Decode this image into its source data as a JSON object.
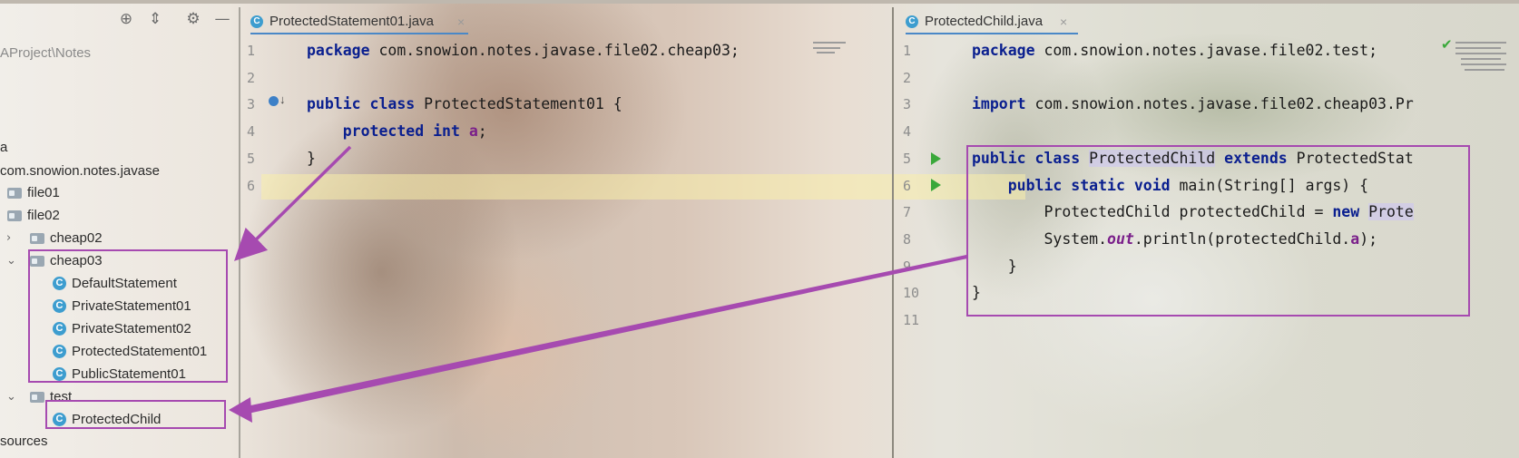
{
  "colors": {
    "accent_box": "#a64ab0",
    "keyword": "#0a1f8f",
    "field": "#7a1f8a",
    "run": "#3aa83a",
    "class_icon": "#3d9dcf"
  },
  "project": {
    "path": "AProject\\Notes",
    "toolbar_icons": [
      "target-icon",
      "collapse-icon",
      "gear-icon",
      "minimize-icon"
    ],
    "tree": [
      {
        "label": "a",
        "type": "text"
      },
      {
        "label": "com.snowion.notes.javase",
        "type": "package"
      },
      {
        "label": "file01",
        "type": "folder"
      },
      {
        "label": "file02",
        "type": "folder"
      },
      {
        "label": "cheap02",
        "type": "folder",
        "expander": "›"
      },
      {
        "label": "cheap03",
        "type": "folder",
        "expander": "⌄"
      },
      {
        "label": "DefaultStatement",
        "type": "class"
      },
      {
        "label": "PrivateStatement01",
        "type": "class"
      },
      {
        "label": "PrivateStatement02",
        "type": "class"
      },
      {
        "label": "ProtectedStatement01",
        "type": "class"
      },
      {
        "label": "PublicStatement01",
        "type": "class"
      },
      {
        "label": "test",
        "type": "folder",
        "expander": "⌄"
      },
      {
        "label": "ProtectedChild",
        "type": "class"
      },
      {
        "label": "sources",
        "type": "text"
      }
    ]
  },
  "left_editor": {
    "tab": {
      "name": "ProtectedStatement01.java",
      "icon": "C",
      "close": "×"
    },
    "line_numbers": [
      "1",
      "2",
      "3",
      "4",
      "5",
      "6"
    ],
    "lines": [
      [
        {
          "t": "package",
          "c": "kw"
        },
        {
          "t": " com.snowion.notes.javase.file02.cheap03;",
          "c": ""
        }
      ],
      [],
      [
        {
          "t": "public class",
          "c": "kw"
        },
        {
          "t": " ProtectedStatement01 {",
          "c": ""
        }
      ],
      [
        {
          "t": "    ",
          "c": ""
        },
        {
          "t": "protected int",
          "c": "kw"
        },
        {
          "t": " ",
          "c": ""
        },
        {
          "t": "a",
          "c": "fld"
        },
        {
          "t": ";",
          "c": ""
        }
      ],
      [
        {
          "t": "}",
          "c": ""
        }
      ],
      []
    ]
  },
  "right_editor": {
    "tab": {
      "name": "ProtectedChild.java",
      "icon": "C",
      "close": "×"
    },
    "line_numbers": [
      "1",
      "2",
      "3",
      "4",
      "5",
      "6",
      "7",
      "8",
      "9",
      "10",
      "11"
    ],
    "lines": [
      [
        {
          "t": "package",
          "c": "kw"
        },
        {
          "t": " com.snowion.notes.javase.file02.test;",
          "c": ""
        }
      ],
      [],
      [
        {
          "t": "import",
          "c": "kw"
        },
        {
          "t": " com.snowion.notes.javase.file02.cheap03.Pr",
          "c": ""
        }
      ],
      [],
      [
        {
          "t": "public class",
          "c": "kw"
        },
        {
          "t": " ",
          "c": ""
        },
        {
          "t": "ProtectedChild",
          "c": "hl"
        },
        {
          "t": " ",
          "c": ""
        },
        {
          "t": "extends",
          "c": "kw"
        },
        {
          "t": " ProtectedStat",
          "c": ""
        }
      ],
      [
        {
          "t": "    ",
          "c": ""
        },
        {
          "t": "public static void",
          "c": "kw"
        },
        {
          "t": " main(String[] args) {",
          "c": ""
        }
      ],
      [
        {
          "t": "        ProtectedChild protectedChild = ",
          "c": ""
        },
        {
          "t": "new",
          "c": "kw"
        },
        {
          "t": " ",
          "c": ""
        },
        {
          "t": "Prote",
          "c": "hl"
        }
      ],
      [
        {
          "t": "        System.",
          "c": ""
        },
        {
          "t": "out",
          "c": "ital"
        },
        {
          "t": ".println(protectedChild.",
          "c": ""
        },
        {
          "t": "a",
          "c": "fld"
        },
        {
          "t": ");",
          "c": ""
        }
      ],
      [
        {
          "t": "    }",
          "c": ""
        }
      ],
      [
        {
          "t": "}",
          "c": ""
        }
      ],
      []
    ]
  }
}
